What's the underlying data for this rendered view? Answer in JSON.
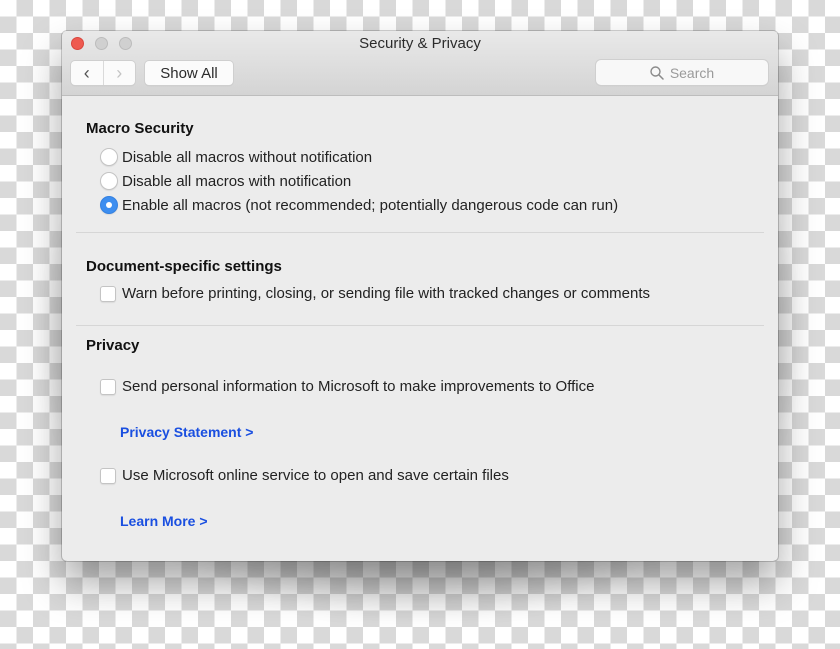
{
  "window": {
    "title": "Security & Privacy",
    "traffic_lights": [
      "close",
      "minimize",
      "zoom"
    ]
  },
  "toolbar": {
    "back_icon": "chevron-left-icon",
    "forward_icon": "chevron-right-icon",
    "back_glyph": "‹",
    "forward_glyph": "›",
    "show_all_label": "Show All",
    "search_placeholder": "Search",
    "search_icon": "magnifier-icon"
  },
  "macro_security": {
    "heading": "Macro Security",
    "options": [
      {
        "label": "Disable all macros without notification",
        "selected": false
      },
      {
        "label": "Disable all macros with notification",
        "selected": false
      },
      {
        "label": "Enable all macros (not recommended; potentially dangerous code can run)",
        "selected": true
      }
    ]
  },
  "document_settings": {
    "heading": "Document-specific settings",
    "options": [
      {
        "label": "Warn before printing, closing, or sending file with tracked changes or comments",
        "checked": false
      }
    ]
  },
  "privacy": {
    "heading": "Privacy",
    "options": [
      {
        "label": "Send personal information to Microsoft to make improvements to Office",
        "checked": false,
        "link": "Privacy Statement >"
      },
      {
        "label": "Use Microsoft online service to open and save certain files",
        "checked": false,
        "link": "Learn More >"
      }
    ]
  },
  "colors": {
    "accent": "#3d8ef0",
    "link": "#1a4fe0",
    "close_button": "#ee5a50"
  }
}
